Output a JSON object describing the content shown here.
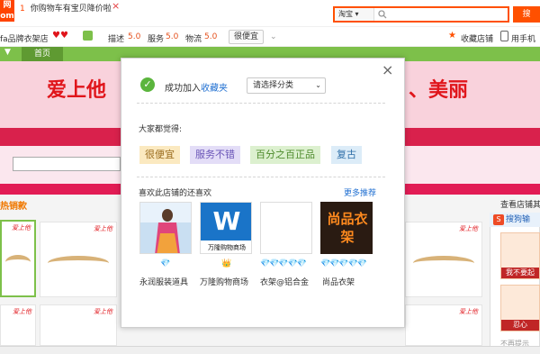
{
  "topbar": {
    "logo_text": "网\nom",
    "notice_num": "1",
    "notice_text": "你购物车有宝贝降价啦",
    "notice_close": "×",
    "search_type": "淘宝",
    "search_type_arrow": "▾",
    "search_icon": "search-icon",
    "search_button": "搜"
  },
  "infobar": {
    "shop_name": "fa品牌衣架店",
    "describe_label": "描述",
    "describe_score": "5.0",
    "service_label": "服务",
    "service_score": "5.0",
    "logistics_label": "物流",
    "logistics_score": "5.0",
    "cheap_button": "很便宜",
    "collect_shop": "收藏店铺",
    "mobile": "用手机"
  },
  "nav": {
    "home": "首页"
  },
  "banner": {
    "left_text": "爱上他",
    "right_text": "、美丽"
  },
  "content": {
    "hot_label": "热销款",
    "right_title": "查看店铺其",
    "product_tag": "爱上他"
  },
  "sogou": {
    "title": "搜狗输",
    "logo": "S",
    "card1_caption": "我不要起",
    "card2_caption": "忍心",
    "no_remind": "不再提示"
  },
  "modal": {
    "close": "×",
    "success_prefix": "成功加入",
    "success_link": "收藏夹",
    "category_placeholder": "请选择分类",
    "category_arrow": "⌄",
    "all_think": "大家都觉得:",
    "tags": [
      {
        "label": "很便宜",
        "bg": "#fbe9c0",
        "color": "#9a6b1c"
      },
      {
        "label": "服务不错",
        "bg": "#e3ddf7",
        "color": "#6b56b8"
      },
      {
        "label": "百分之百正品",
        "bg": "#dcf0cf",
        "color": "#4c8a2a"
      },
      {
        "label": "复古",
        "bg": "#dcecf8",
        "color": "#2f6fa8"
      }
    ],
    "liked_title": "喜欢此店铺的还喜欢",
    "more_link": "更多推荐",
    "shops": [
      {
        "name": "永润服装道具",
        "rating": "💎"
      },
      {
        "name": "万隆购物商场",
        "rating": "👑",
        "logo_text": "万隆购物商场"
      },
      {
        "name": "衣架@铝合金",
        "rating": "💎💎💎💎💎"
      },
      {
        "name": "尚品衣架",
        "rating": "💎💎💎💎💎",
        "logo_text": "尚品衣架"
      }
    ]
  },
  "colors": {
    "accent": "#ff5000",
    "nav_green": "#7dc04a",
    "banner_pink": "#f9d2dc",
    "banner_text": "#e0151b",
    "success_green": "#5bb53d",
    "link_blue": "#1f6fd1"
  }
}
